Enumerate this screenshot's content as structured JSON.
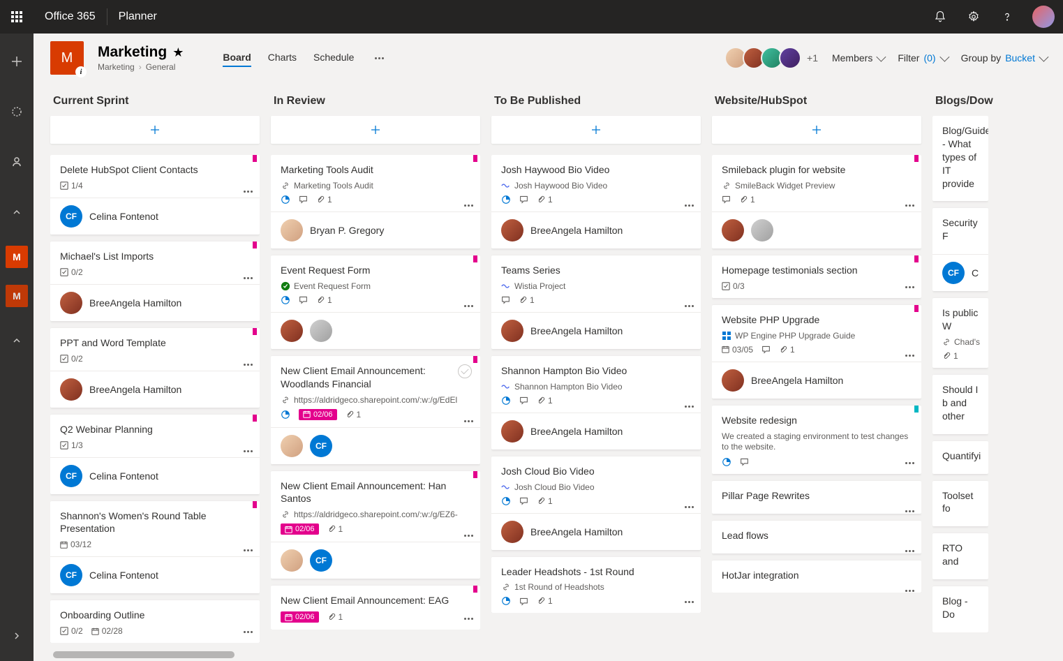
{
  "topbar": {
    "suite": "Office 365",
    "app": "Planner"
  },
  "plan": {
    "icon_letter": "M",
    "title": "Marketing",
    "breadcrumb_root": "Marketing",
    "breadcrumb_leaf": "General"
  },
  "tabs": {
    "board": "Board",
    "charts": "Charts",
    "schedule": "Schedule"
  },
  "header": {
    "members_more": "+1",
    "members_label": "Members",
    "filter_label": "Filter",
    "filter_count": "(0)",
    "group_label": "Group by",
    "group_value": "Bucket"
  },
  "buckets": [
    {
      "name": "Current Sprint",
      "tasks": [
        {
          "title": "Delete HubSpot Client Contacts",
          "checklist": "1/4",
          "pin": "pink",
          "assignees": [
            {
              "type": "cf",
              "label": "CF"
            }
          ],
          "assignee_name": "Celina Fontenot"
        },
        {
          "title": "Michael's List Imports",
          "checklist": "0/2",
          "pin": "pink",
          "assignees": [
            {
              "type": "bh"
            }
          ],
          "assignee_name": "BreeAngela Hamilton"
        },
        {
          "title": "PPT and Word Template",
          "checklist": "0/2",
          "pin": "pink",
          "assignees": [
            {
              "type": "bh"
            }
          ],
          "assignee_name": "BreeAngela Hamilton"
        },
        {
          "title": "Q2 Webinar Planning",
          "checklist": "1/3",
          "pin": "pink",
          "assignees": [
            {
              "type": "cf",
              "label": "CF"
            }
          ],
          "assignee_name": "Celina Fontenot"
        },
        {
          "title": "Shannon's Women's Round Table Presentation",
          "date_plain": "03/12",
          "pin": "pink",
          "assignees": [
            {
              "type": "cf",
              "label": "CF"
            }
          ],
          "assignee_name": "Celina Fontenot"
        },
        {
          "title": "Onboarding Outline",
          "date_plain": "02/28",
          "checklist": "0/2"
        }
      ]
    },
    {
      "name": "In Review",
      "tasks": [
        {
          "title": "Marketing Tools Audit",
          "link_text": "Marketing Tools Audit",
          "link_icon": "link",
          "pin": "pink",
          "progress": true,
          "comments": true,
          "attachments": "1",
          "assignees": [
            {
              "type": "bg"
            }
          ],
          "assignee_name": "Bryan P. Gregory"
        },
        {
          "title": "Event Request Form",
          "link_text": "Event Request Form",
          "link_icon": "green",
          "pin": "pink",
          "progress": true,
          "comments": true,
          "attachments": "1",
          "assignees": [
            {
              "type": "bh"
            },
            {
              "type": "grey"
            }
          ]
        },
        {
          "title": "New Client Email Announcement: Woodlands Financial",
          "link_text": "https://aldridgeco.sharepoint.com/:w:/g/EdEl",
          "link_icon": "link",
          "pin": "pink",
          "progress": true,
          "date_badge": "02/06",
          "attachments": "1",
          "show_complete": true,
          "assignees": [
            {
              "type": "bg"
            },
            {
              "type": "cf",
              "label": "CF"
            }
          ]
        },
        {
          "title": "New Client Email Announcement: Han Santos",
          "link_text": "https://aldridgeco.sharepoint.com/:w:/g/EZ6-",
          "link_icon": "link",
          "pin": "pink",
          "date_badge": "02/06",
          "attachments": "1",
          "assignees": [
            {
              "type": "bg"
            },
            {
              "type": "cf",
              "label": "CF"
            }
          ]
        },
        {
          "title": "New Client Email Announcement: EAG",
          "pin": "pink",
          "date_badge": "02/06",
          "attachments": "1"
        }
      ]
    },
    {
      "name": "To Be Published",
      "tasks": [
        {
          "title": "Josh Haywood Bio Video",
          "link_text": "Josh Haywood Bio Video",
          "link_icon": "wave",
          "progress": true,
          "comments": true,
          "attachments": "1",
          "assignees": [
            {
              "type": "bh"
            }
          ],
          "assignee_name": "BreeAngela Hamilton"
        },
        {
          "title": "Teams Series",
          "link_text": "Wistia Project",
          "link_icon": "wave",
          "comments": true,
          "attachments": "1",
          "assignees": [
            {
              "type": "bh"
            }
          ],
          "assignee_name": "BreeAngela Hamilton"
        },
        {
          "title": "Shannon Hampton Bio Video",
          "link_text": "Shannon Hampton Bio Video",
          "link_icon": "wave",
          "progress": true,
          "comments": true,
          "attachments": "1",
          "assignees": [
            {
              "type": "bh"
            }
          ],
          "assignee_name": "BreeAngela Hamilton"
        },
        {
          "title": "Josh Cloud Bio Video",
          "link_text": "Josh Cloud Bio Video",
          "link_icon": "wave",
          "progress": true,
          "comments": true,
          "attachments": "1",
          "assignees": [
            {
              "type": "bh"
            }
          ],
          "assignee_name": "BreeAngela Hamilton"
        },
        {
          "title": "Leader Headshots - 1st Round",
          "link_text": "1st Round of Headshots",
          "link_icon": "link",
          "progress": true,
          "comments": true,
          "attachments": "1"
        }
      ]
    },
    {
      "name": "Website/HubSpot",
      "tasks": [
        {
          "title": "Smileback plugin for website",
          "link_text": "SmileBack Widget Preview",
          "link_icon": "link",
          "pin": "pink",
          "comments": true,
          "attachments": "1",
          "assignees": [
            {
              "type": "bh"
            },
            {
              "type": "grey"
            }
          ]
        },
        {
          "title": "Homepage testimonials section",
          "checklist": "0/3",
          "pin": "pink"
        },
        {
          "title": "Website PHP Upgrade",
          "link_text": "WP Engine PHP Upgrade Guide",
          "link_icon": "grid",
          "pin": "pink",
          "date_plain": "03/05",
          "comments": true,
          "attachments": "1",
          "assignees": [
            {
              "type": "bh"
            }
          ],
          "assignee_name": "BreeAngela Hamilton"
        },
        {
          "title": "Website redesign",
          "description": "We created a staging environment to test changes to the website.",
          "pin": "cyan",
          "progress": true,
          "comments": true
        },
        {
          "title": "Pillar Page Rewrites"
        },
        {
          "title": "Lead flows"
        },
        {
          "title": "HotJar integration"
        }
      ]
    },
    {
      "name": "Blogs/Dow",
      "partial": true,
      "tasks": [
        {
          "title": "Blog/Guide - What types of IT provide"
        },
        {
          "title": "Security F",
          "assignees": [
            {
              "type": "cf",
              "label": "CF"
            }
          ],
          "assignee_name": "C"
        },
        {
          "title": "Is public W",
          "link_text": "Chad's",
          "link_icon": "link",
          "attachments": "1"
        },
        {
          "title": "Should I b and other"
        },
        {
          "title": "Quantifyi"
        },
        {
          "title": "Toolset fo"
        },
        {
          "title": "RTO and"
        },
        {
          "title": "Blog - Do"
        }
      ]
    }
  ]
}
